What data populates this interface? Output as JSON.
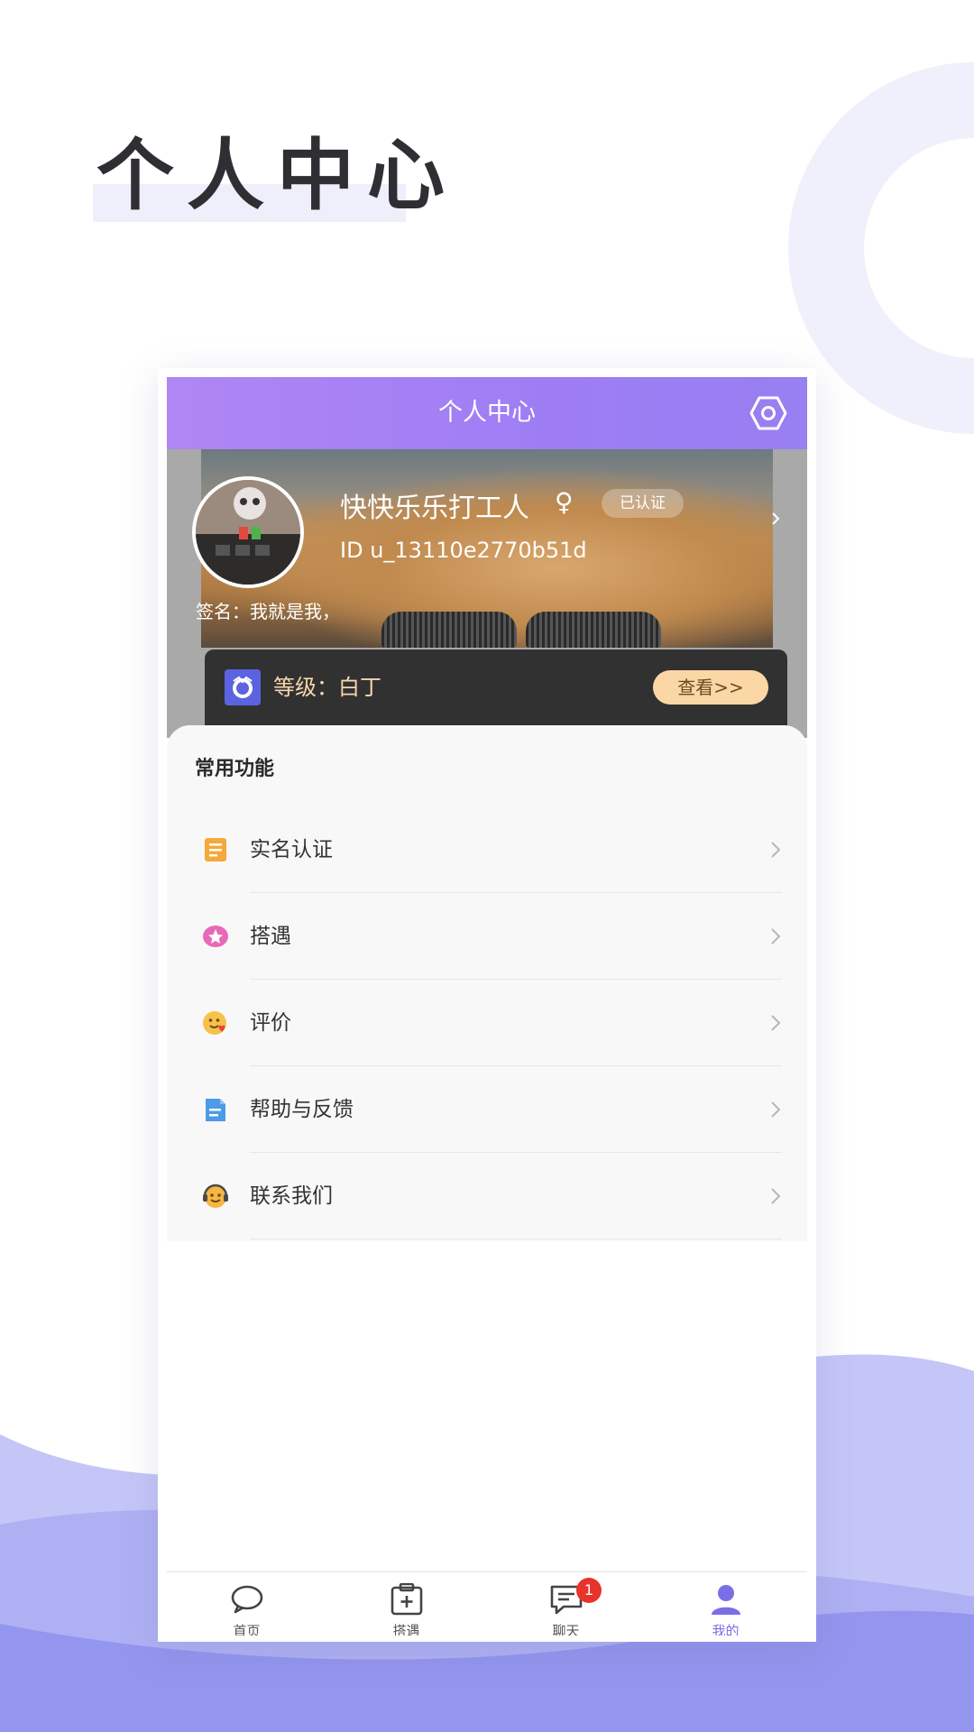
{
  "page_title": "个人中心",
  "app": {
    "header_title": "个人中心",
    "icons": {
      "settings": "hexagon-gear-icon"
    }
  },
  "profile": {
    "nickname": "快快乐乐打工人",
    "gender_symbol": "♀",
    "verified_badge": "已认证",
    "user_id": "ID u_13110e2770b51d",
    "signature": "签名：我就是我，"
  },
  "level": {
    "text": "等级：白丁",
    "view_button": "查看>>"
  },
  "common_functions": {
    "title": "常用功能",
    "items": [
      {
        "label": "实名认证",
        "icon": "id-card-note-icon",
        "color": "#f4a93a"
      },
      {
        "label": "搭遇",
        "icon": "pink-star-bubble-icon",
        "color": "#e968b8"
      },
      {
        "label": "评价",
        "icon": "smiley-heart-icon",
        "color": "#f7c24a"
      },
      {
        "label": "帮助与反馈",
        "icon": "document-icon",
        "color": "#4d9ae8"
      },
      {
        "label": "联系我们",
        "icon": "headset-smiley-icon",
        "color": "#f5b642"
      }
    ]
  },
  "tabbar": {
    "items": [
      {
        "label": "首页",
        "icon": "chat-bubble-icon",
        "active": false
      },
      {
        "label": "搭遇",
        "icon": "calendar-plus-icon",
        "active": false
      },
      {
        "label": "聊天",
        "icon": "message-icon",
        "active": false,
        "badge": "1"
      },
      {
        "label": "我的",
        "icon": "person-icon",
        "active": true
      }
    ]
  },
  "colors": {
    "header_gradient_start": "#b086f3",
    "header_gradient_end": "#987ff2",
    "accent": "#7a6fe6",
    "level_button": "#fbd7a6",
    "badge": "#e8332b"
  }
}
